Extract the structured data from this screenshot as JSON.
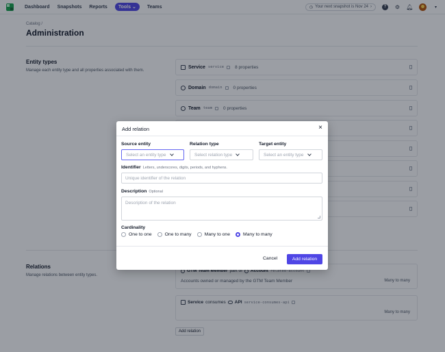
{
  "nav": {
    "items": [
      "Dashboard",
      "Snapshots",
      "Reports",
      "Tools",
      "Teams"
    ],
    "active": "Tools",
    "snapshot_text": "Your next snapshot is Nov 24"
  },
  "page": {
    "breadcrumb": "Catalog /",
    "title": "Administration"
  },
  "entity_types": {
    "title": "Entity types",
    "description": "Manage each entity type and all properties associated with them.",
    "items": [
      {
        "icon": "server-icon",
        "name": "Service",
        "key": "service",
        "properties": "8 properties"
      },
      {
        "icon": "globe-icon",
        "name": "Domain",
        "key": "domain",
        "properties": "0 properties"
      },
      {
        "icon": "team-icon",
        "name": "Team",
        "key": "team",
        "properties": "0 properties"
      }
    ]
  },
  "relations": {
    "title": "Relations",
    "description": "Manage relations between entity types.",
    "items": [
      {
        "source": "GTM Team Member",
        "verb": "part of",
        "target": "Account",
        "key": "related-account",
        "description": "Accounts owned or managed by the GTM Team Member",
        "cardinality": "Many to many"
      },
      {
        "source": "Service",
        "verb": "consumes",
        "target": "API",
        "key": "service-consumes-api",
        "description": "",
        "cardinality": "Many to many"
      }
    ],
    "add_button": "Add relation"
  },
  "modal": {
    "title": "Add relation",
    "source_label": "Source entity",
    "source_placeholder": "Select an entity type",
    "relation_label": "Relation type",
    "relation_placeholder": "Select relation type",
    "target_label": "Target entity",
    "target_placeholder": "Select an entity type",
    "identifier_label": "Identifier",
    "identifier_hint": "Letters, underscores, digits, periods, and hyphens.",
    "identifier_placeholder": "Unique identifier of the relation",
    "description_label": "Description",
    "description_optional": "Optional",
    "description_placeholder": "Description of the relation",
    "cardinality_label": "Cardinality",
    "cardinality_options": [
      "One to one",
      "One to many",
      "Many to one",
      "Many to many"
    ],
    "cardinality_selected": "Many to many",
    "cancel_label": "Cancel",
    "submit_label": "Add relation"
  },
  "colors": {
    "accent": "#4f46e5",
    "overlay": "rgba(17,24,39,0.42)"
  }
}
